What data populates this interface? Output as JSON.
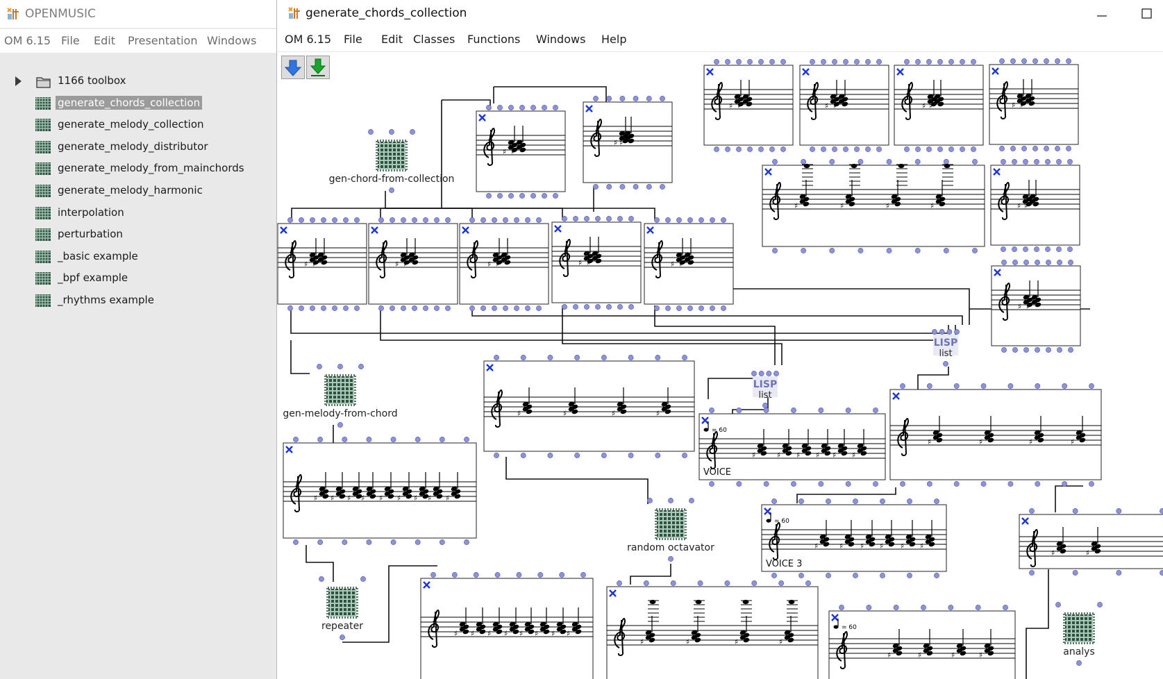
{
  "workspace": {
    "title": "OPENMUSIC",
    "menu": [
      "OM 6.15",
      "File",
      "Edit",
      "Presentation",
      "Windows"
    ],
    "items": [
      {
        "label": "1166 toolbox",
        "kind": "folder",
        "selected": false
      },
      {
        "label": "generate_chords_collection",
        "kind": "patch",
        "selected": true
      },
      {
        "label": "generate_melody_collection",
        "kind": "patch",
        "selected": false
      },
      {
        "label": "generate_melody_distributor",
        "kind": "patch",
        "selected": false
      },
      {
        "label": "generate_melody_from_mainchords",
        "kind": "patch",
        "selected": false
      },
      {
        "label": "generate_melody_harmonic",
        "kind": "patch",
        "selected": false
      },
      {
        "label": "interpolation",
        "kind": "patch",
        "selected": false
      },
      {
        "label": "perturbation",
        "kind": "patch",
        "selected": false
      },
      {
        "label": "_basic example",
        "kind": "patch",
        "selected": false
      },
      {
        "label": "_bpf example",
        "kind": "patch",
        "selected": false
      },
      {
        "label": "_rhythms example",
        "kind": "patch",
        "selected": false
      }
    ]
  },
  "patch_window": {
    "title": "generate_chords_collection",
    "menu": [
      "OM 6.15",
      "File",
      "Edit",
      "Classes",
      "Functions",
      "Windows",
      "Help"
    ],
    "toolbar": {
      "down_icon": "blue-down-arrow-icon",
      "import_icon": "green-down-arrow-icon"
    },
    "window_buttons": {
      "minimize_icon": "minimize-icon",
      "maximize_icon": "maximize-icon"
    },
    "boxes": {
      "gen_chord": "gen-chord-from-collection",
      "gen_melody": "gen-melody-from-chord",
      "random_octavator": "random octavator",
      "repeater": "repeater",
      "lisp1_title": "LISP",
      "lisp1_name": "list",
      "lisp2_title": "LISP",
      "lisp2_name": "list",
      "voice1_label": "VOICE",
      "voice3_label": "VOICE 3",
      "tempo": "= 60",
      "partial_label": "analys"
    }
  },
  "colors": {
    "accent_blue": "#1b35d8",
    "inlet": "#8e93d8",
    "lisp": "#6d73b5",
    "selection": "#9b9b9b"
  }
}
